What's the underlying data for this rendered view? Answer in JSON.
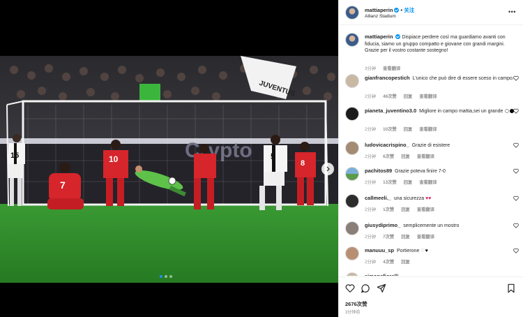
{
  "post": {
    "username": "mattiaperin",
    "separator": "•",
    "follow_label": "关注",
    "location": "Allianz Stadium",
    "more_label": "•••"
  },
  "media": {
    "banner_text": "JUVENTUS",
    "ad_text": "Crypto",
    "jerseys": [
      "15",
      "10",
      "5",
      "8",
      "7"
    ],
    "carousel": {
      "count": 3,
      "active": 0
    }
  },
  "caption": {
    "username": "mattiaperin",
    "text": "Dispiace perdere così ma guardiamo avanti con fiducia, siamo un gruppo compatto e giovane con grandi margini. Grazie per il vostro costante sostegno!",
    "time": "3分钟",
    "translate": "查看翻译"
  },
  "comments": [
    {
      "username": "gianfrancopestich",
      "text": "L'unico che può dire di essere sceso in campo.",
      "time": "2分钟",
      "likes": "46次赞",
      "reply": "回复",
      "translate": "查看翻译"
    },
    {
      "username": "pianeta_juventino3.0",
      "text": "Migliore in campo mattia,sei un grande",
      "time": "2分钟",
      "likes": "10次赞",
      "reply": "回复",
      "translate": "查看翻译"
    },
    {
      "username": "ludovicacrispino_",
      "text": "Grazie di esistere",
      "time": "2分钟",
      "likes": "6次赞",
      "reply": "回复",
      "translate": "查看翻译"
    },
    {
      "username": "pachitos89",
      "text": "Grazie poteva finire 7-0",
      "time": "2分钟",
      "likes": "13次赞",
      "reply": "回复",
      "translate": "查看翻译"
    },
    {
      "username": "callmeeli._",
      "text": "una sicurezza",
      "time": "2分钟",
      "likes": "1次赞",
      "reply": "回复",
      "translate": "查看翻译"
    },
    {
      "username": "giusydiprimo_",
      "text": "semplicemente un mostro",
      "time": "2分钟",
      "likes": "7次赞",
      "reply": "回复",
      "translate": "查看翻译"
    },
    {
      "username": "manuuu_sp",
      "text": "Portierone",
      "time": "2分钟",
      "likes": "4次赞",
      "reply": "回复",
      "translate": ""
    },
    {
      "username": "simonefiorelli",
      "text": "",
      "time": "",
      "likes": "",
      "reply": "",
      "translate": ""
    }
  ],
  "footer": {
    "likes": "2676次赞",
    "time": "3分钟前"
  },
  "colors": {
    "accent": "#0095f6",
    "juve_red": "#d6252b",
    "pitch": "#2f8f2a"
  }
}
